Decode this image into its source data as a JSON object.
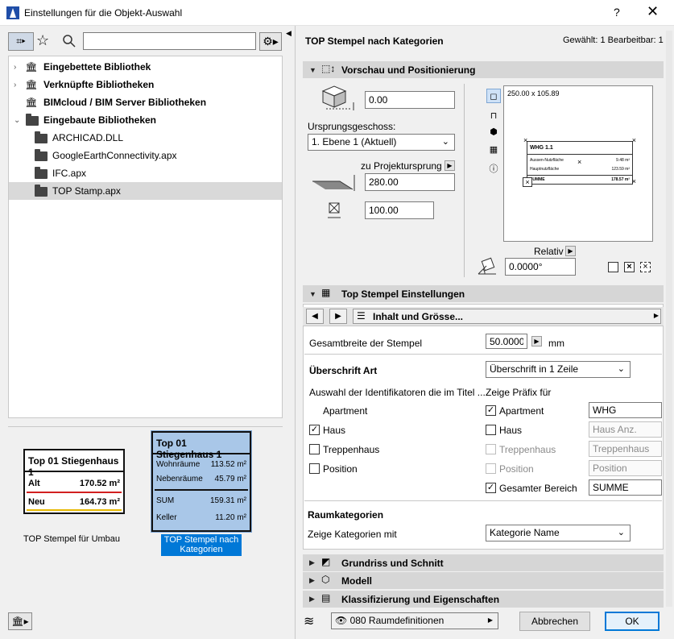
{
  "window": {
    "title": "Einstellungen für die Objekt-Auswahl",
    "help": "?",
    "close": "✕"
  },
  "left": {
    "search": {
      "value": "",
      "placeholder": ""
    },
    "tree": [
      {
        "label": "Eingebettete Bibliothek",
        "bold": true,
        "arrow": "›",
        "icon": "library-icon"
      },
      {
        "label": "Verknüpfte Bibliotheken",
        "bold": true,
        "arrow": "›",
        "icon": "linked-library-icon"
      },
      {
        "label": "BIMcloud / BIM Server Bibliotheken",
        "bold": true,
        "arrow": "",
        "icon": "bimcloud-icon"
      },
      {
        "label": "Eingebaute Bibliotheken",
        "bold": true,
        "arrow": "⌄",
        "icon": "folder-icon"
      },
      {
        "label": "ARCHICAD.DLL",
        "bold": false,
        "arrow": "",
        "icon": "folder-icon"
      },
      {
        "label": "GoogleEarthConnectivity.apx",
        "bold": false,
        "arrow": "",
        "icon": "folder-icon"
      },
      {
        "label": "IFC.apx",
        "bold": false,
        "arrow": "",
        "icon": "folder-icon"
      },
      {
        "label": "TOP Stamp.apx",
        "bold": false,
        "arrow": "",
        "icon": "folder-icon",
        "selected": true
      }
    ],
    "previews": {
      "umbau": {
        "title": "Top 01 Stiegenhaus 1",
        "rows": [
          {
            "label": "Alt",
            "value": "170.52 m²"
          },
          {
            "label": "Neu",
            "value": "164.73 m²"
          }
        ],
        "caption": "TOP Stempel für Umbau",
        "alt_color": "#d22020",
        "neu_color": "#e6b800"
      },
      "kategorien": {
        "title": "Top 01 Stiegenhaus 1",
        "rows": [
          {
            "label": "Wohnräume",
            "value": "113.52 m²"
          },
          {
            "label": "Nebenräume",
            "value": "45.79 m²"
          },
          {
            "label": "SUM",
            "value": "159.31 m²"
          },
          {
            "label": "Keller",
            "value": "11.20 m²"
          }
        ],
        "caption": "TOP Stempel nach Kategorien",
        "bg": "#a9c7e8",
        "caption_bg": "#0078d7"
      }
    }
  },
  "right": {
    "header": {
      "title": "TOP Stempel nach Kategorien",
      "status": "Gewählt: 1 Bearbeitbar: 1"
    },
    "vorschau": {
      "section": "Vorschau und Positionierung",
      "elevation": "0.00",
      "ursprung_label": "Ursprungsgeschoss:",
      "ursprung_value": "1. Ebene 1 (Aktuell)",
      "projekt_label": "zu Projektursprung",
      "projekt_value": "280.00",
      "size_value": "100.00",
      "dims": "250.00 x 105.89",
      "mini": {
        "title": "WHG 1.1",
        "r1": "Aussen-Nutzfläche",
        "r1v": "9.48 m²",
        "r2": "Hauptnutzfläche",
        "r2v": "123.59 m²",
        "r3": "SUMME",
        "r3v": "178.57 m²"
      },
      "relativ": "Relativ",
      "angle": "0.0000°"
    },
    "top": {
      "section": "Top Stempel Einstellungen",
      "page": "Inhalt und Grösse...",
      "gesamtbreite_label": "Gesamtbreite der Stempel",
      "gesamtbreite_value": "50.0000",
      "unit": "mm",
      "ueberschrift_label": "Überschrift Art",
      "ueberschrift_value": "Überschrift in 1 Zeile",
      "auswahl_label": "Auswahl der Identifikatoren die im Titel ...",
      "praefix_label": "Zeige Präfix für",
      "apartment_label": "Apartment",
      "left_items": [
        {
          "label": "Haus",
          "checked": true
        },
        {
          "label": "Treppenhaus",
          "checked": false
        },
        {
          "label": "Position",
          "checked": false
        }
      ],
      "right_items": [
        {
          "label": "Apartment",
          "checked": true,
          "value": "WHG",
          "disabled": false
        },
        {
          "label": "Haus",
          "checked": false,
          "value": "Haus Anz.",
          "disabled": true
        },
        {
          "label": "Treppenhaus",
          "checked": false,
          "value": "Treppenhaus",
          "disabled": true
        },
        {
          "label": "Position",
          "checked": false,
          "value": "Position",
          "disabled": true
        },
        {
          "label": "Gesamter Bereich",
          "checked": true,
          "value": "SUMME",
          "disabled": false
        }
      ],
      "raum_label": "Raumkategorien",
      "zeige_label": "Zeige Kategorien mit",
      "zeige_value": "Kategorie Name"
    },
    "sections": [
      "Grundriss und Schnitt",
      "Modell",
      "Klassifizierung und Eigenschaften"
    ],
    "footer": {
      "layer": "080 Raumdefinitionen",
      "cancel": "Abbrechen",
      "ok": "OK"
    }
  }
}
